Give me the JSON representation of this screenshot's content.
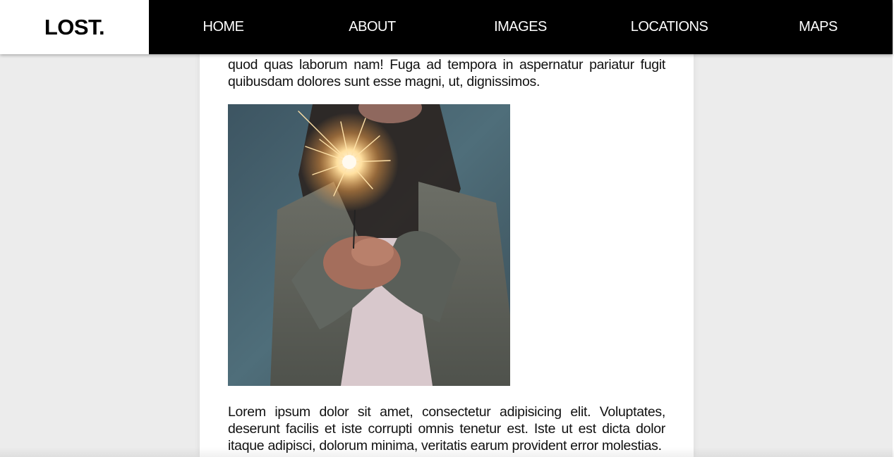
{
  "brand": {
    "logo": "LOST."
  },
  "nav": {
    "items": [
      {
        "label": "HOME"
      },
      {
        "label": "ABOUT"
      },
      {
        "label": "IMAGES"
      },
      {
        "label": "LOCATIONS"
      },
      {
        "label": "MAPS"
      }
    ]
  },
  "article": {
    "paragraph_top": "quod quas laborum nam! Fuga ad tempora in aspernatur pariatur fugit quibusdam dolores sunt esse magni, ut, dignissimos.",
    "paragraph_bottom": "Lorem ipsum dolor sit amet, consectetur adipisicing elit. Voluptates, deserunt facilis et iste corrupti omnis tenetur est. Iste ut est dicta dolor itaque adipisci, dolorum minima, veritatis earum provident error molestias."
  },
  "colors": {
    "nav_bg": "#000000",
    "page_bg": "#ececec",
    "content_bg": "#ffffff"
  }
}
